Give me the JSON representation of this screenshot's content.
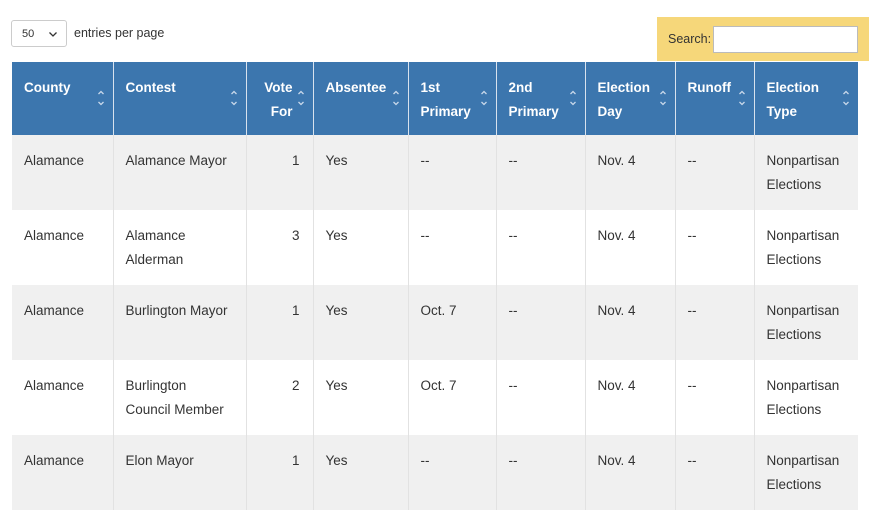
{
  "controls": {
    "page_length": "50",
    "page_length_suffix": "entries per page",
    "search_label": "Search:",
    "search_value": ""
  },
  "table": {
    "columns": [
      {
        "label": "County"
      },
      {
        "label": "Contest"
      },
      {
        "label": "Vote For"
      },
      {
        "label": "Absentee"
      },
      {
        "label": "1st Primary"
      },
      {
        "label": "2nd Primary"
      },
      {
        "label": "Election Day"
      },
      {
        "label": "Runoff"
      },
      {
        "label": "Election Type"
      }
    ],
    "rows": [
      {
        "county": "Alamance",
        "contest": "Alamance Mayor",
        "vote_for": "1",
        "absentee": "Yes",
        "first_primary": "--",
        "second_primary": "--",
        "election_day": "Nov. 4",
        "runoff": "--",
        "election_type": "Nonpartisan Elections"
      },
      {
        "county": "Alamance",
        "contest": "Alamance Alderman",
        "vote_for": "3",
        "absentee": "Yes",
        "first_primary": "--",
        "second_primary": "--",
        "election_day": "Nov. 4",
        "runoff": "--",
        "election_type": "Nonpartisan Elections"
      },
      {
        "county": "Alamance",
        "contest": "Burlington Mayor",
        "vote_for": "1",
        "absentee": "Yes",
        "first_primary": "Oct. 7",
        "second_primary": "--",
        "election_day": "Nov. 4",
        "runoff": "--",
        "election_type": "Nonpartisan Elections"
      },
      {
        "county": "Alamance",
        "contest": "Burlington Council Member",
        "vote_for": "2",
        "absentee": "Yes",
        "first_primary": "Oct. 7",
        "second_primary": "--",
        "election_day": "Nov. 4",
        "runoff": "--",
        "election_type": "Nonpartisan Elections"
      },
      {
        "county": "Alamance",
        "contest": "Elon Mayor",
        "vote_for": "1",
        "absentee": "Yes",
        "first_primary": "--",
        "second_primary": "--",
        "election_day": "Nov. 4",
        "runoff": "--",
        "election_type": "Nonpartisan Elections"
      }
    ]
  },
  "colors": {
    "header_bg": "#3c76ae",
    "search_bg": "#f6d77a",
    "row_stripe": "#f0f0f0"
  }
}
